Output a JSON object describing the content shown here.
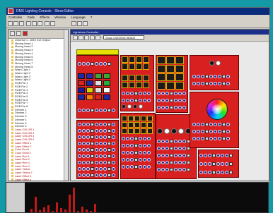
{
  "window": {
    "title": "DMX Lighting Console - Show Editor"
  },
  "menu": {
    "items": [
      "Controller",
      "Fade",
      "Effects",
      "Window",
      "Language",
      "?"
    ]
  },
  "tree": {
    "items": [
      {
        "label": "Universe 1 - DMX 512 Output"
      },
      {
        "label": "Moving Head 1"
      },
      {
        "label": "Moving Head 2"
      },
      {
        "label": "Moving Head 3"
      },
      {
        "label": "Moving Head 4"
      },
      {
        "label": "Moving Head 5"
      },
      {
        "label": "Moving Head 6"
      },
      {
        "label": "Moving Head 7"
      },
      {
        "label": "Moving Head 8"
      },
      {
        "label": "Wash Light 1"
      },
      {
        "label": "Wash Light 2"
      },
      {
        "label": "Wash Light 3"
      },
      {
        "label": "Wash Light 4"
      },
      {
        "label": "RGB Par 1"
      },
      {
        "label": "RGB Par 2"
      },
      {
        "label": "RGB Par 3"
      },
      {
        "label": "RGB Par 4"
      },
      {
        "label": "RGB Par 5"
      },
      {
        "label": "RGB Par 6"
      },
      {
        "label": "RGB Par 7"
      },
      {
        "label": "RGB Par 8"
      },
      {
        "label": "Dimmer 1"
      },
      {
        "label": "Dimmer 2"
      },
      {
        "label": "Dimmer 3"
      },
      {
        "label": "Dimmer 4"
      },
      {
        "label": "Dimmer 5"
      },
      {
        "label": "Dimmer 6"
      },
      {
        "label": "Laser COLOR 1"
      },
      {
        "label": "Laser COLOR 2"
      },
      {
        "label": "Laser COLOR 3"
      },
      {
        "label": "Laser COLOR 4"
      },
      {
        "label": "Laser Effect 1"
      },
      {
        "label": "Laser Effect 2"
      },
      {
        "label": "Color Scroll"
      },
      {
        "label": "Color Scroll 2"
      },
      {
        "label": "Laser Red 1"
      },
      {
        "label": "Laser Red 2"
      },
      {
        "label": "Laser Red 3"
      },
      {
        "label": "Laser Red 4"
      },
      {
        "label": "Laser Yellow"
      },
      {
        "label": "Laser Yellow 2"
      },
      {
        "label": "Laser Effect 3"
      },
      {
        "label": "Laser Effect 4"
      },
      {
        "label": "Laser Effect 5"
      },
      {
        "label": "Laser Red 5"
      },
      {
        "label": "Laser Effect 6"
      }
    ]
  },
  "editor": {
    "title": "Lightshow Controller",
    "dropdown_value": "Group 4 MOVING HEADS"
  },
  "colors": {
    "panel_red": "#d92020",
    "editor_bg": "#e9e9e9",
    "window_teal": "#139aa6",
    "accent_blue": "#1b2f8a",
    "bar_red": "#c41818"
  },
  "levels": {
    "bars": [
      0.12,
      0.55,
      0.08,
      0.18,
      0.25,
      0.06,
      0.35,
      0.14,
      0.09,
      0.62,
      0.88,
      0.05,
      0.2,
      0.1,
      0.04,
      0.3
    ]
  }
}
